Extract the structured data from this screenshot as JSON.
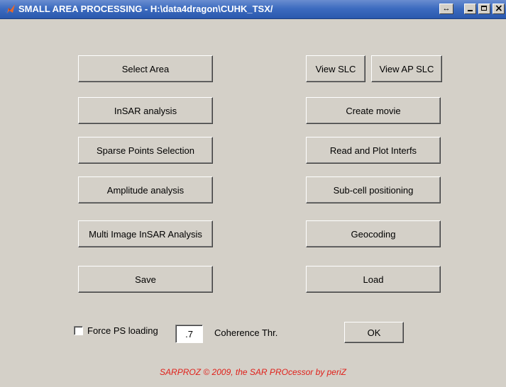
{
  "window": {
    "title": "SMALL AREA PROCESSING - H:\\data4dragon\\CUHK_TSX/",
    "dock_glyph": "↔",
    "close_glyph": "×"
  },
  "left_buttons": {
    "select_area": "Select Area",
    "insar_analysis": "InSAR analysis",
    "sparse_points": "Sparse Points Selection",
    "amplitude_analysis": "Amplitude analysis",
    "multi_image": "Multi Image InSAR Analysis",
    "save": "Save"
  },
  "right_buttons": {
    "view_slc": "View SLC",
    "view_ap_slc": "View AP SLC",
    "create_movie": "Create movie",
    "read_plot": "Read and Plot Interfs",
    "subcell": "Sub-cell positioning",
    "geocoding": "Geocoding",
    "load": "Load"
  },
  "options": {
    "force_ps_label": "Force PS loading",
    "force_ps_checked": false,
    "coherence_value": ".7",
    "coherence_label": "Coherence Thr.",
    "ok_label": "OK"
  },
  "footer": {
    "credit": "SARPROZ © 2009, the SAR PROcessor by periZ"
  },
  "colors": {
    "face": "#d4d0c8",
    "titlebar": "#3d6cc0",
    "footer_text": "#e0201a"
  }
}
